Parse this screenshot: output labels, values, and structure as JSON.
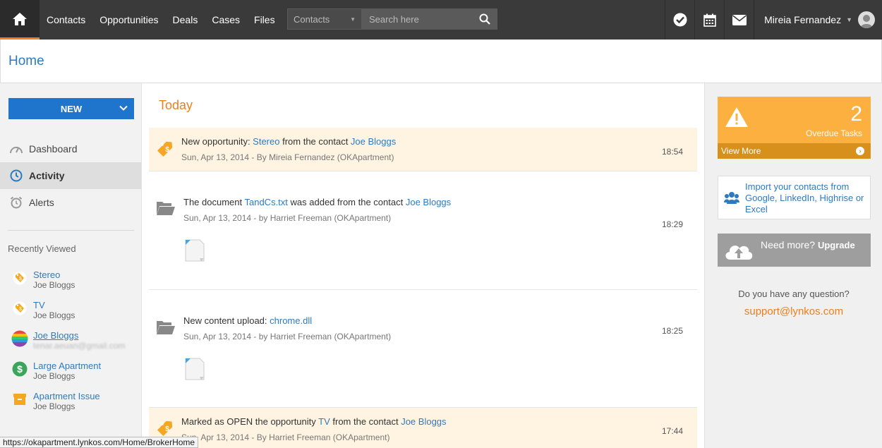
{
  "topbar": {
    "nav": [
      "Contacts",
      "Opportunities",
      "Deals",
      "Cases",
      "Files"
    ],
    "search": {
      "select_value": "Contacts",
      "placeholder": "Search here"
    },
    "user_name": "Mireia Fernandez"
  },
  "page": {
    "title": "Home"
  },
  "sidebar": {
    "new_label": "NEW",
    "nav": [
      {
        "label": "Dashboard",
        "icon": "dashboard-icon"
      },
      {
        "label": "Activity",
        "icon": "activity-icon",
        "active": true
      },
      {
        "label": "Alerts",
        "icon": "alarm-icon"
      }
    ],
    "recently_viewed_title": "Recently Viewed",
    "recently_viewed": [
      {
        "name": "Stereo",
        "sub": "Joe Bloggs",
        "icon": "opportunity-tag-icon"
      },
      {
        "name": "TV",
        "sub": "Joe Bloggs",
        "icon": "opportunity-tag-icon"
      },
      {
        "name": "Joe Bloggs",
        "sub": "tenar.aeuan@gmail.com",
        "icon": "contact-avatar"
      },
      {
        "name": "Large Apartment",
        "sub": "Joe Bloggs",
        "icon": "deal-dollar-icon"
      },
      {
        "name": "Apartment Issue",
        "sub": "Joe Bloggs",
        "icon": "case-box-icon"
      }
    ]
  },
  "feed": {
    "heading": "Today",
    "items": [
      {
        "pre": "New opportunity: ",
        "link1": "Stereo",
        "mid": " from the contact ",
        "link2": "Joe Bloggs",
        "meta": "Sun, Apr 13, 2014 - By Mireia Fernandez (OKApartment)",
        "time": "18:54"
      },
      {
        "pre": "The document ",
        "link1": "TandCs.txt",
        "mid": " was added from the contact ",
        "link2": "Joe Bloggs",
        "meta": "Sun, Apr 13, 2014 - by Harriet Freeman (OKApartment)",
        "time": "18:29"
      },
      {
        "pre": "New content upload: ",
        "link1": "chrome.dll",
        "mid": "",
        "link2": "",
        "meta": "Sun, Apr 13, 2014 - by Harriet Freeman (OKApartment)",
        "time": "18:25"
      },
      {
        "pre": "Marked as OPEN the opportunity ",
        "link1": "TV",
        "mid": " from the contact ",
        "link2": "Joe Bloggs",
        "meta": "Sun, Apr 13, 2014 - By Harriet Freeman (OKApartment)",
        "time": "17:44"
      }
    ]
  },
  "right": {
    "overdue_count": "2",
    "overdue_label": "Overdue Tasks",
    "view_more": "View More",
    "import_text": "Import your contacts from Google, LinkedIn, Highrise or Excel",
    "need_more": "Need more?",
    "upgrade": "Upgrade",
    "question": "Do you have any question?",
    "support_email": "support@lynkos.com"
  },
  "status_url": "https://okapartment.lynkos.com/Home/BrokerHome",
  "colors": {
    "accent": "#f07e1d",
    "link": "#2d7ac0",
    "primary_button": "#1f75cb",
    "overdue": "#fbb040"
  }
}
